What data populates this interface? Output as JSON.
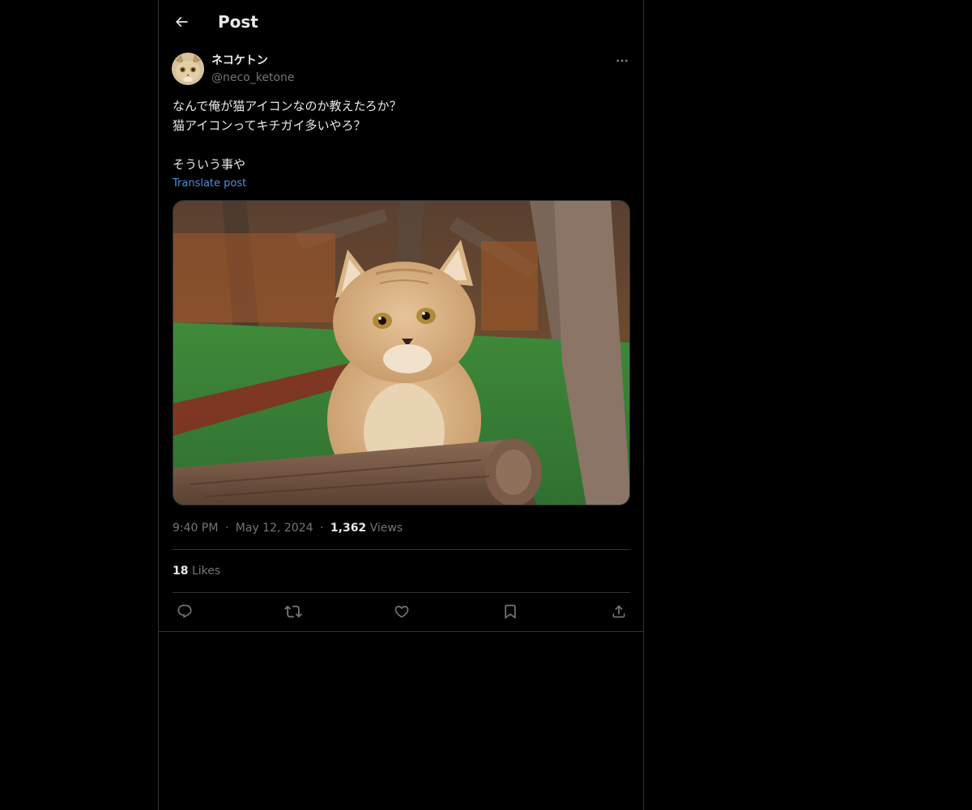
{
  "header": {
    "title": "Post",
    "back_icon": "arrow-left-icon"
  },
  "author": {
    "display_name": "ネコケトン",
    "handle": "@neco_ketone",
    "avatar": "cat-avatar"
  },
  "post": {
    "text": "なんで俺が猫アイコンなのか教えたろか？\n猫アイコンってキチガイ多いやろ？\n\nそういう事や",
    "translate_label": "Translate post",
    "image": "sand-cat-kitten-photo"
  },
  "meta": {
    "time": "9:40 PM",
    "separator": "·",
    "date": "May 12, 2024",
    "views_count": "1,362",
    "views_label": "Views"
  },
  "stats": {
    "likes_count": "18",
    "likes_label": "Likes"
  },
  "actions": {
    "reply_icon": "reply-icon",
    "repost_icon": "repost-icon",
    "like_icon": "heart-icon",
    "bookmark_icon": "bookmark-icon",
    "share_icon": "share-icon"
  },
  "colors": {
    "background": "#000000",
    "text_primary": "#e7e9ea",
    "text_secondary": "#71767b",
    "link": "#4f8fd6",
    "border": "#2f3336"
  }
}
